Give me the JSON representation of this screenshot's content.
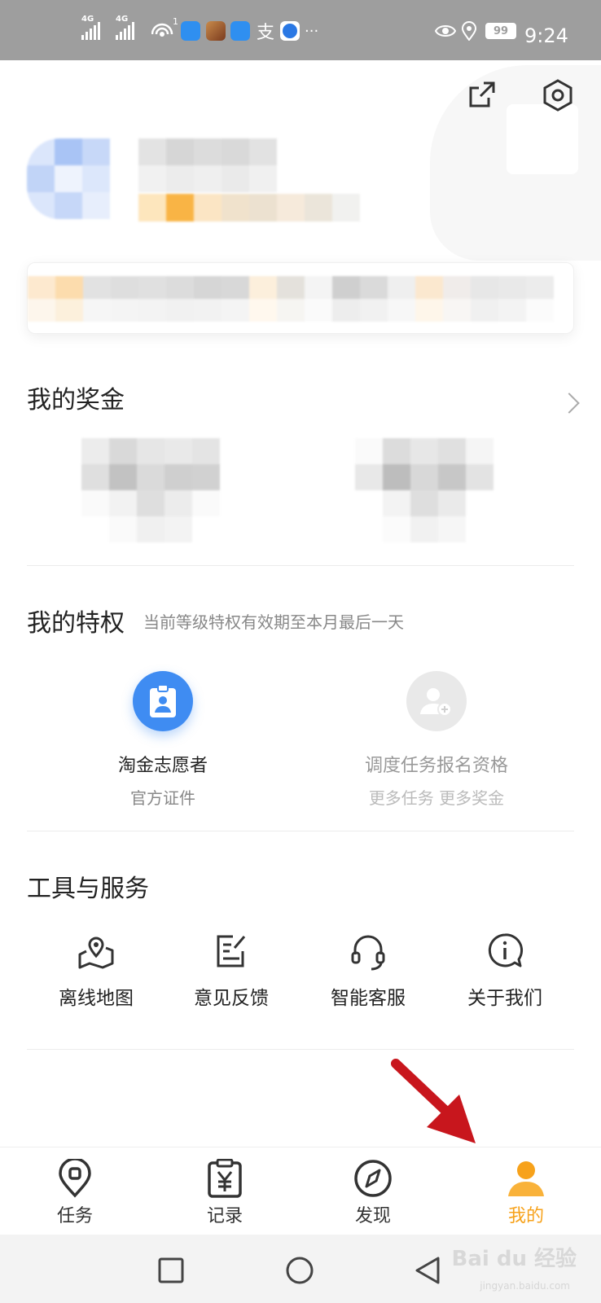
{
  "status_bar": {
    "network_1": "4G",
    "network_2": "4G",
    "hotspot_count": "1",
    "alipay_glyph": "支",
    "more": "···",
    "battery": "99",
    "time": "9:24"
  },
  "header": {
    "share_icon": "share-icon",
    "settings_icon": "settings-icon"
  },
  "bonus": {
    "title": "我的奖金"
  },
  "privileges": {
    "title": "我的特权",
    "subtitle": "当前等级特权有效期至本月最后一天",
    "items": [
      {
        "title": "淘金志愿者",
        "subtitle": "官方证件",
        "icon": "badge-icon",
        "active": true
      },
      {
        "title": "调度任务报名资格",
        "subtitle": "更多任务 更多奖金",
        "icon": "add-user-icon",
        "active": false
      }
    ]
  },
  "tools": {
    "title": "工具与服务",
    "items": [
      {
        "label": "离线地图",
        "icon": "map-icon"
      },
      {
        "label": "意见反馈",
        "icon": "feedback-icon"
      },
      {
        "label": "智能客服",
        "icon": "headset-icon"
      },
      {
        "label": "关于我们",
        "icon": "info-icon"
      }
    ]
  },
  "bottom_nav": {
    "items": [
      {
        "label": "任务",
        "icon": "location-pin-icon",
        "active": false
      },
      {
        "label": "记录",
        "icon": "clipboard-yen-icon",
        "active": false
      },
      {
        "label": "发现",
        "icon": "compass-icon",
        "active": false
      },
      {
        "label": "我的",
        "icon": "person-icon",
        "active": true
      }
    ]
  },
  "watermark": {
    "brand": "Bai du 经验",
    "url": "jingyan.baidu.com"
  },
  "colors": {
    "accent": "#f7a21b",
    "blue": "#3f8cf2",
    "text": "#222222",
    "muted": "#888888",
    "statusbar": "#9e9e9e"
  }
}
